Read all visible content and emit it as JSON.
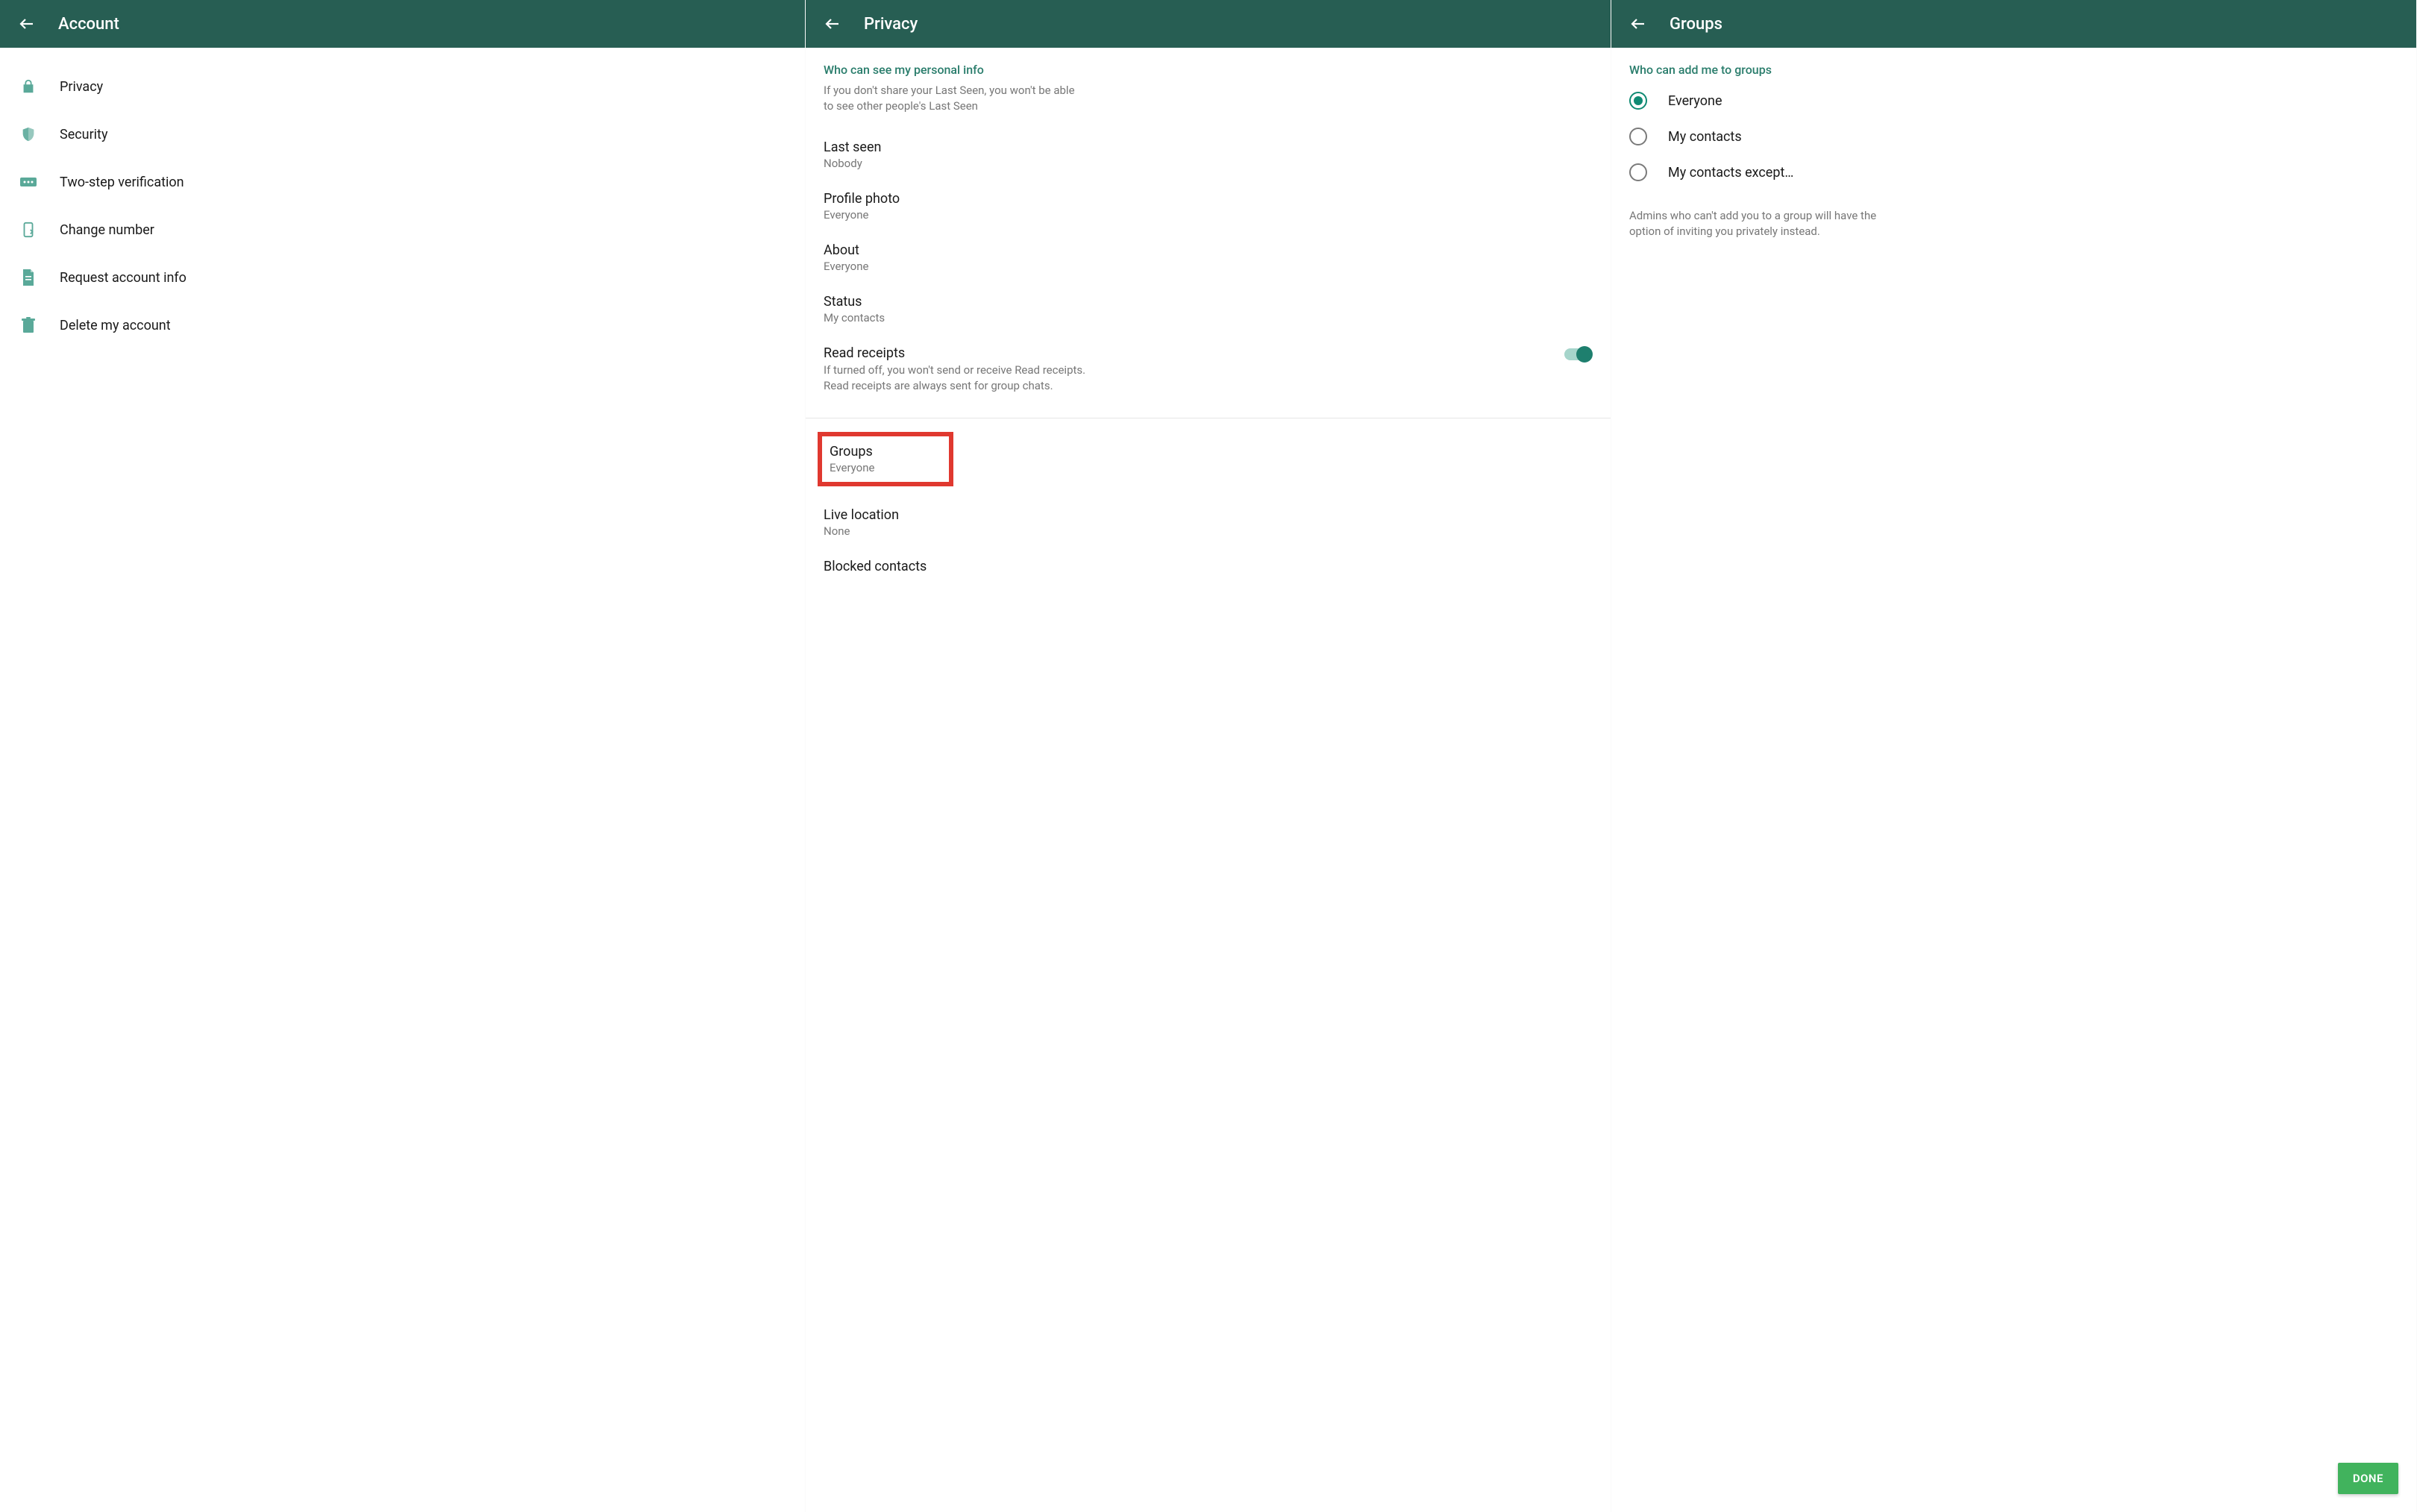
{
  "account": {
    "title": "Account",
    "items": [
      {
        "icon": "lock",
        "label": "Privacy"
      },
      {
        "icon": "shield",
        "label": "Security"
      },
      {
        "icon": "pin",
        "label": "Two-step verification"
      },
      {
        "icon": "phone",
        "label": "Change number"
      },
      {
        "icon": "doc",
        "label": "Request account info"
      },
      {
        "icon": "trash",
        "label": "Delete my account"
      }
    ]
  },
  "privacy": {
    "title": "Privacy",
    "section_title": "Who can see my personal info",
    "section_sub": "If you don't share your Last Seen, you won't be able to see other people's Last Seen",
    "last_seen": {
      "title": "Last seen",
      "value": "Nobody"
    },
    "profile_photo": {
      "title": "Profile photo",
      "value": "Everyone"
    },
    "about": {
      "title": "About",
      "value": "Everyone"
    },
    "status": {
      "title": "Status",
      "value": "My contacts"
    },
    "read_receipts": {
      "title": "Read receipts",
      "desc": "If turned off, you won't send or receive Read receipts. Read receipts are always sent for group chats.",
      "on": true
    },
    "groups": {
      "title": "Groups",
      "value": "Everyone"
    },
    "live_location": {
      "title": "Live location",
      "value": "None"
    },
    "blocked": {
      "title": "Blocked contacts"
    }
  },
  "groups": {
    "title": "Groups",
    "section_title": "Who can add me to groups",
    "options": [
      {
        "label": "Everyone",
        "selected": true
      },
      {
        "label": "My contacts",
        "selected": false
      },
      {
        "label": "My contacts except…",
        "selected": false
      }
    ],
    "note": "Admins who can't add you to a group will have the option of inviting you privately instead.",
    "done": "DONE"
  }
}
